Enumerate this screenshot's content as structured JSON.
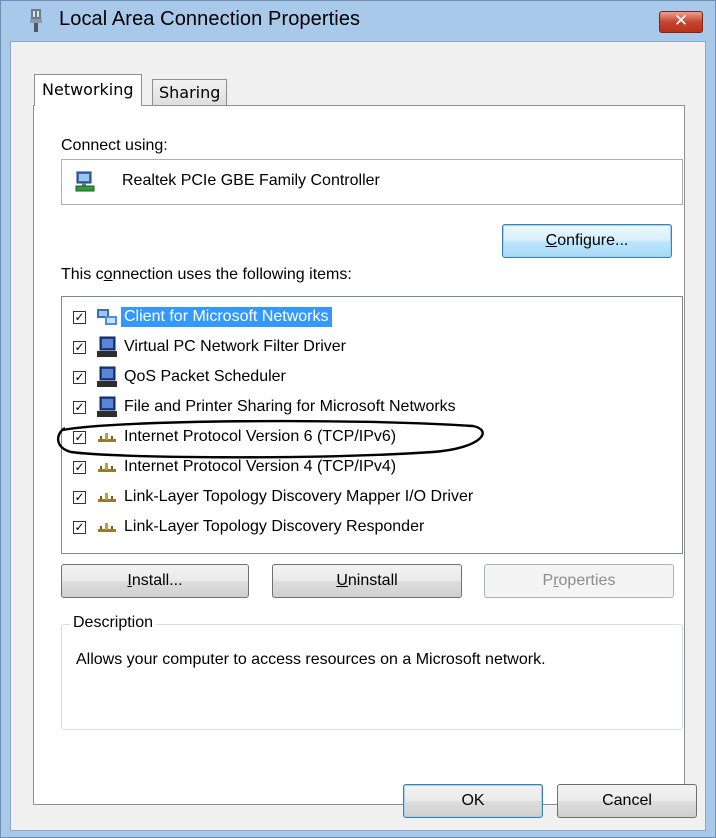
{
  "window": {
    "title": "Local Area Connection Properties",
    "close_glyph": "✕"
  },
  "tabs": [
    {
      "label": "Networking",
      "selected": true
    },
    {
      "label": "Sharing",
      "selected": false
    }
  ],
  "connect_using": {
    "label": "Connect using:",
    "adapter": "Realtek PCIe GBE Family Controller",
    "configure_pre": "",
    "configure_accel": "C",
    "configure_post": "onfigure..."
  },
  "items_section": {
    "label_pre": "This c",
    "label_accel": "o",
    "label_post": "nnection uses the following items:"
  },
  "items": [
    {
      "label": "Client for Microsoft Networks",
      "checked": true,
      "icon": "network-client-icon",
      "selected": true
    },
    {
      "label": "Virtual PC Network Filter Driver",
      "checked": true,
      "icon": "network-service-icon",
      "selected": false
    },
    {
      "label": "QoS Packet Scheduler",
      "checked": true,
      "icon": "network-service-icon",
      "selected": false
    },
    {
      "label": "File and Printer Sharing for Microsoft Networks",
      "checked": true,
      "icon": "network-service-icon",
      "selected": false
    },
    {
      "label": "Internet Protocol Version 6 (TCP/IPv6)",
      "checked": true,
      "icon": "protocol-icon",
      "selected": false
    },
    {
      "label": "Internet Protocol Version 4 (TCP/IPv4)",
      "checked": true,
      "icon": "protocol-icon",
      "selected": false
    },
    {
      "label": "Link-Layer Topology Discovery Mapper I/O Driver",
      "checked": true,
      "icon": "protocol-icon",
      "selected": false
    },
    {
      "label": "Link-Layer Topology Discovery Responder",
      "checked": true,
      "icon": "protocol-icon",
      "selected": false
    }
  ],
  "buttons": {
    "install_accel": "I",
    "install_post": "nstall...",
    "uninstall_accel": "U",
    "uninstall_post": "ninstall",
    "properties_pre": "P",
    "properties_accel": "r",
    "properties_post": "operties",
    "ok": "OK",
    "cancel": "Cancel"
  },
  "description": {
    "legend": "Description",
    "text": "Allows your computer to access resources on a Microsoft network."
  },
  "colors": {
    "selection": "#3399ff",
    "title_bar": "#a9c9ea",
    "close_button": "#c7452e"
  }
}
